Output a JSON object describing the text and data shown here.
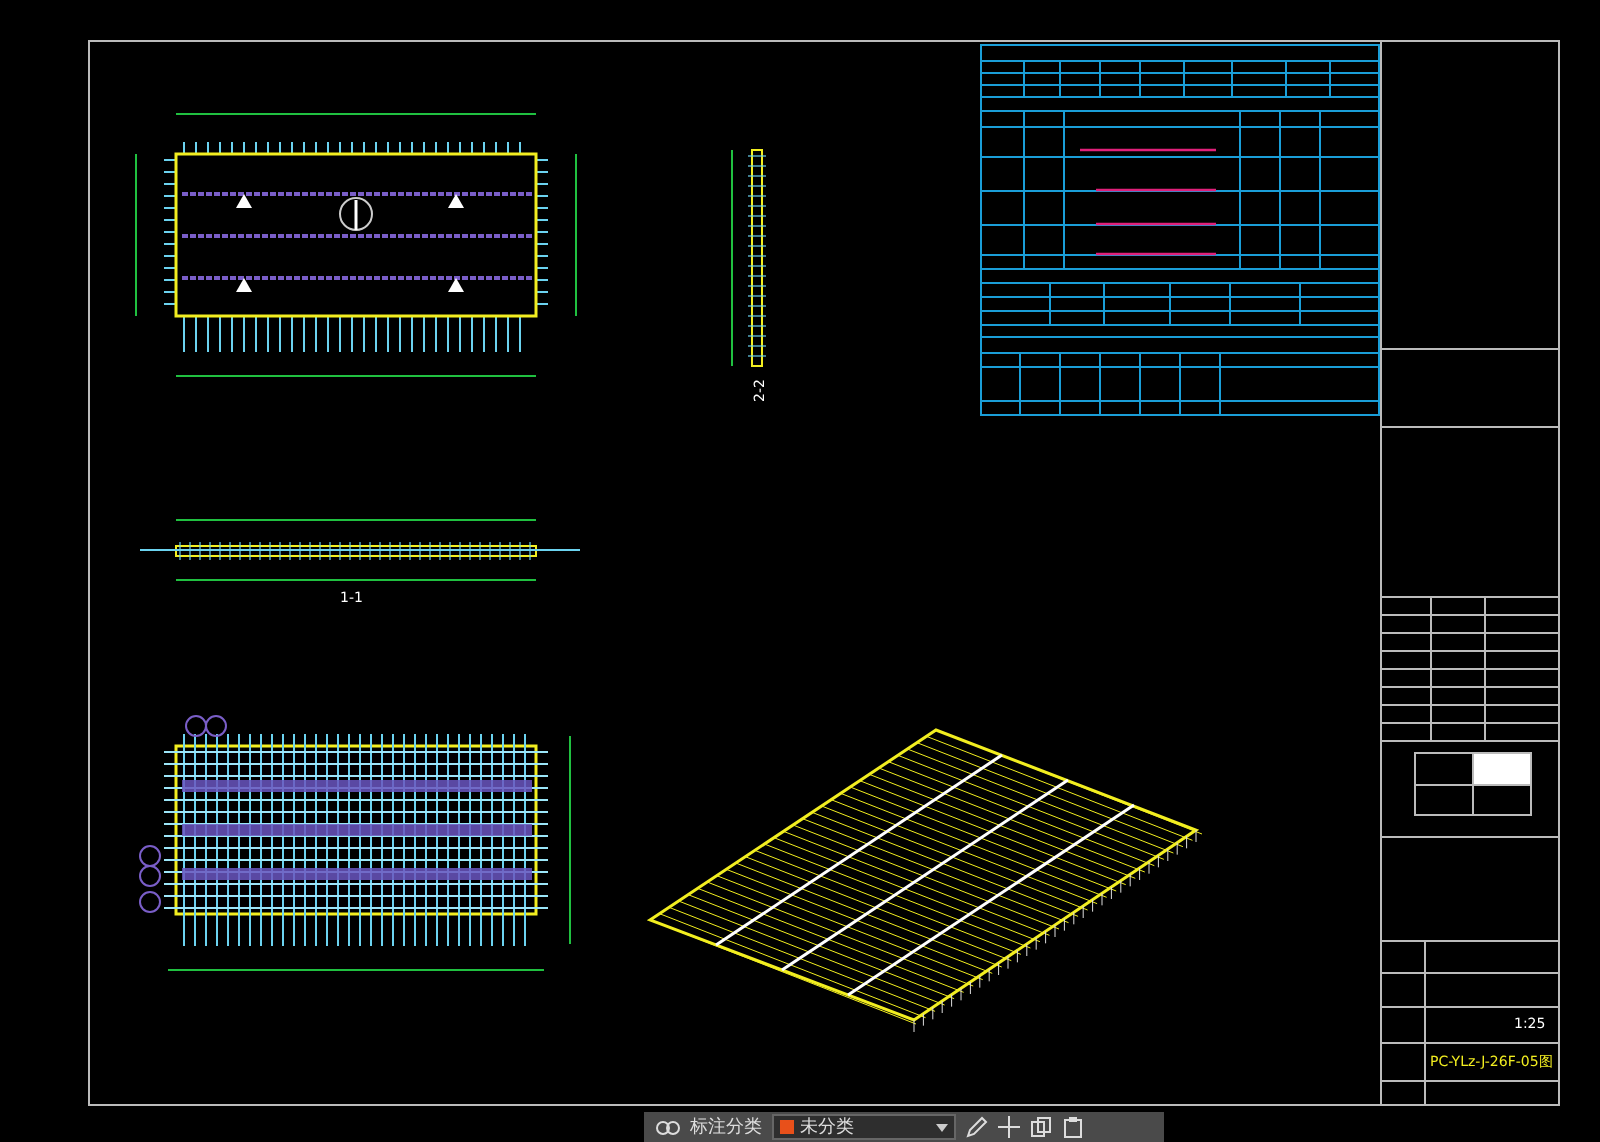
{
  "sheet": {
    "section_labels": [
      {
        "text": "1-1",
        "kind": "horizontal"
      },
      {
        "text": "2-2",
        "kind": "vertical"
      }
    ],
    "title_block": {
      "scale": "1:25",
      "drawing_number": "PC-YLz-J-26F-05图"
    }
  },
  "toolbar": {
    "category_label": "标注分类",
    "category_value": "未分类"
  }
}
